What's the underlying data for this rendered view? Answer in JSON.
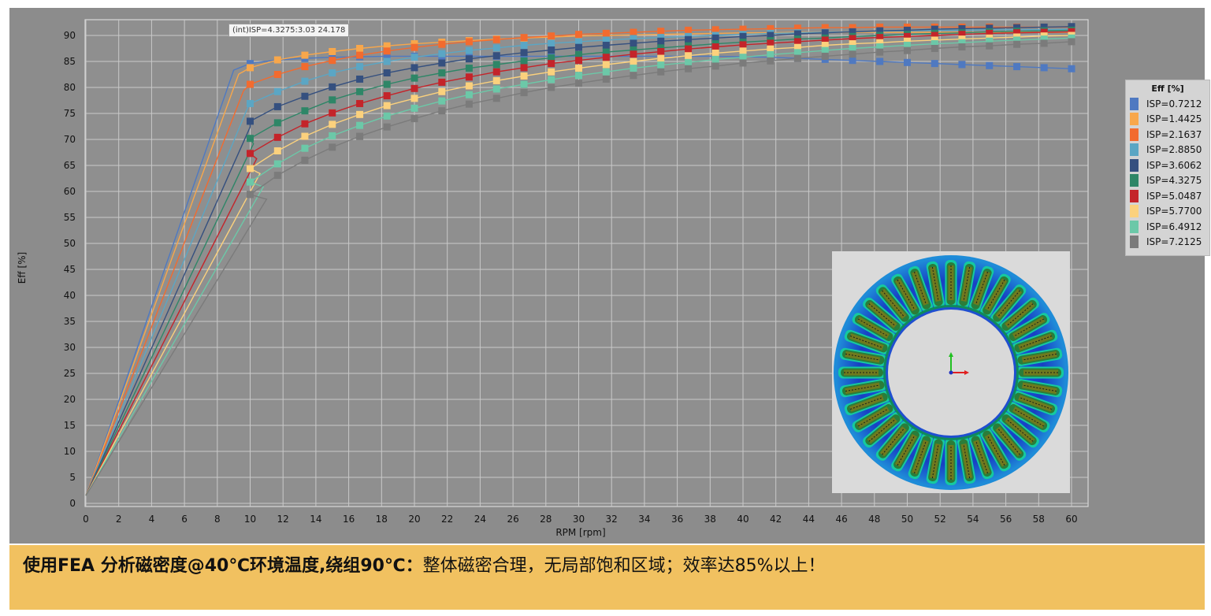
{
  "tooltip": "(int)ISP=4.3275:3.03 24.178",
  "banner": {
    "bold": "使用FEA 分析磁密度@40℃环境温度,绕组90℃：",
    "normal": "整体磁密合理，无局部饱和区域；效率达85%以上！"
  },
  "legend": {
    "title": "Eff [%]"
  },
  "chart_data": {
    "type": "line",
    "xlabel": "RPM [rpm]",
    "ylabel": "Eff [%]",
    "xlim": [
      0,
      60
    ],
    "ylim": [
      0,
      92
    ],
    "xticks": [
      0,
      2,
      4,
      6,
      8,
      10,
      12,
      14,
      16,
      18,
      20,
      22,
      24,
      26,
      28,
      30,
      32,
      34,
      36,
      38,
      40,
      42,
      44,
      46,
      48,
      50,
      52,
      54,
      56,
      58,
      60
    ],
    "yticks": [
      0,
      5,
      10,
      15,
      20,
      25,
      30,
      35,
      40,
      45,
      50,
      55,
      60,
      65,
      70,
      75,
      80,
      85,
      90
    ],
    "grid": true,
    "legend_position": "right",
    "marker_x": [
      10,
      11.67,
      13.33,
      15,
      16.67,
      18.33,
      20,
      21.67,
      23.33,
      25,
      26.67,
      28.33,
      30,
      31.67,
      33.33,
      35,
      36.67,
      38.33,
      40,
      41.67,
      43.33,
      45,
      46.67,
      48.33,
      50,
      51.67,
      53.33,
      55,
      56.67,
      58.33,
      60
    ],
    "series": [
      {
        "name": "ISP=0.7212",
        "color": "#4f79c1",
        "knee": 9.0,
        "values": [
          84.6,
          85.3,
          85.6,
          85.8,
          85.9,
          86.0,
          86.0,
          86.0,
          86.0,
          86.0,
          86.0,
          86.0,
          86.0,
          86.0,
          86.0,
          86.0,
          86.0,
          86.0,
          85.9,
          85.8,
          85.6,
          85.4,
          85.2,
          85.0,
          84.8,
          84.6,
          84.4,
          84.2,
          84.0,
          83.8,
          83.6
        ]
      },
      {
        "name": "ISP=1.4425",
        "color": "#f8a74b",
        "knee": 9.3,
        "values": [
          83.8,
          85.3,
          86.2,
          86.9,
          87.5,
          88.0,
          88.4,
          88.7,
          89.0,
          89.3,
          89.5,
          89.7,
          89.9,
          90.0,
          90.1,
          90.2,
          90.3,
          90.4,
          90.5,
          90.5,
          90.6,
          90.6,
          90.6,
          90.6,
          90.6,
          90.6,
          90.6,
          90.6,
          90.6,
          90.6,
          90.6
        ]
      },
      {
        "name": "ISP=2.1637",
        "color": "#f26b2f",
        "knee": 9.6,
        "values": [
          80.6,
          82.5,
          84.0,
          85.2,
          86.2,
          87.0,
          87.7,
          88.3,
          88.8,
          89.2,
          89.6,
          89.9,
          90.2,
          90.4,
          90.6,
          90.8,
          91.0,
          91.1,
          91.2,
          91.3,
          91.4,
          91.5,
          91.5,
          91.6,
          91.6,
          91.6,
          91.6,
          91.6,
          91.6,
          91.6,
          91.6
        ]
      },
      {
        "name": "ISP=2.8850",
        "color": "#5ba6c4",
        "knee": 9.8,
        "values": [
          76.9,
          79.2,
          81.2,
          82.8,
          84.0,
          85.0,
          85.8,
          86.5,
          87.1,
          87.6,
          88.1,
          88.5,
          88.8,
          89.1,
          89.4,
          89.6,
          89.8,
          90.0,
          90.2,
          90.4,
          90.5,
          90.6,
          90.7,
          90.8,
          90.9,
          91.0,
          91.0,
          91.1,
          91.1,
          91.1,
          91.2
        ]
      },
      {
        "name": "ISP=3.6062",
        "color": "#35507f",
        "knee": 10.0,
        "values": [
          73.5,
          76.3,
          78.3,
          80.1,
          81.6,
          82.8,
          83.8,
          84.7,
          85.5,
          86.1,
          86.7,
          87.2,
          87.7,
          88.1,
          88.5,
          88.9,
          89.2,
          89.5,
          89.8,
          90.0,
          90.3,
          90.5,
          90.7,
          90.9,
          91.0,
          91.2,
          91.3,
          91.4,
          91.5,
          91.6,
          91.7
        ]
      },
      {
        "name": "ISP=4.3275",
        "color": "#2e8667",
        "knee": 10.2,
        "values": [
          70.2,
          73.2,
          75.5,
          77.6,
          79.2,
          80.6,
          81.8,
          82.8,
          83.7,
          84.4,
          85.1,
          85.7,
          86.3,
          86.8,
          87.2,
          87.6,
          88.0,
          88.4,
          88.7,
          89.0,
          89.3,
          89.5,
          89.8,
          90.0,
          90.2,
          90.4,
          90.5,
          90.7,
          90.8,
          90.9,
          91.0
        ]
      },
      {
        "name": "ISP=5.0487",
        "color": "#c4242a",
        "knee": 10.4,
        "values": [
          67.3,
          70.4,
          73.0,
          75.1,
          76.9,
          78.4,
          79.8,
          81.0,
          82.0,
          83.0,
          83.8,
          84.6,
          85.2,
          85.8,
          86.4,
          86.9,
          87.4,
          87.8,
          88.2,
          88.5,
          88.8,
          89.1,
          89.4,
          89.6,
          89.8,
          90.0,
          90.2,
          90.4,
          90.5,
          90.6,
          90.7
        ]
      },
      {
        "name": "ISP=5.7700",
        "color": "#fbd17d",
        "knee": 10.6,
        "values": [
          64.4,
          67.8,
          70.6,
          72.9,
          74.8,
          76.5,
          77.9,
          79.2,
          80.3,
          81.3,
          82.2,
          83.0,
          83.7,
          84.4,
          85.0,
          85.6,
          86.1,
          86.6,
          87.0,
          87.4,
          87.7,
          88.1,
          88.4,
          88.6,
          88.9,
          89.1,
          89.3,
          89.5,
          89.7,
          89.9,
          90.0
        ]
      },
      {
        "name": "ISP=6.4912",
        "color": "#6cc8a8",
        "knee": 10.8,
        "values": [
          61.8,
          65.3,
          68.3,
          70.7,
          72.7,
          74.5,
          76.0,
          77.4,
          78.6,
          79.7,
          80.6,
          81.5,
          82.3,
          83.0,
          83.7,
          84.3,
          84.8,
          85.4,
          85.8,
          86.3,
          86.7,
          87.1,
          87.5,
          87.8,
          88.1,
          88.4,
          88.6,
          88.9,
          89.1,
          89.3,
          89.5
        ]
      },
      {
        "name": "ISP=7.2125",
        "color": "#7b7b7b",
        "knee": 11.0,
        "values": [
          59.4,
          63.1,
          66.0,
          68.5,
          70.6,
          72.4,
          74.0,
          75.5,
          76.8,
          77.9,
          79.0,
          80.0,
          80.8,
          81.6,
          82.3,
          83.0,
          83.6,
          84.1,
          84.7,
          85.1,
          85.6,
          86.0,
          86.4,
          86.8,
          87.1,
          87.5,
          87.8,
          88.0,
          88.3,
          88.5,
          88.8
        ]
      }
    ]
  }
}
